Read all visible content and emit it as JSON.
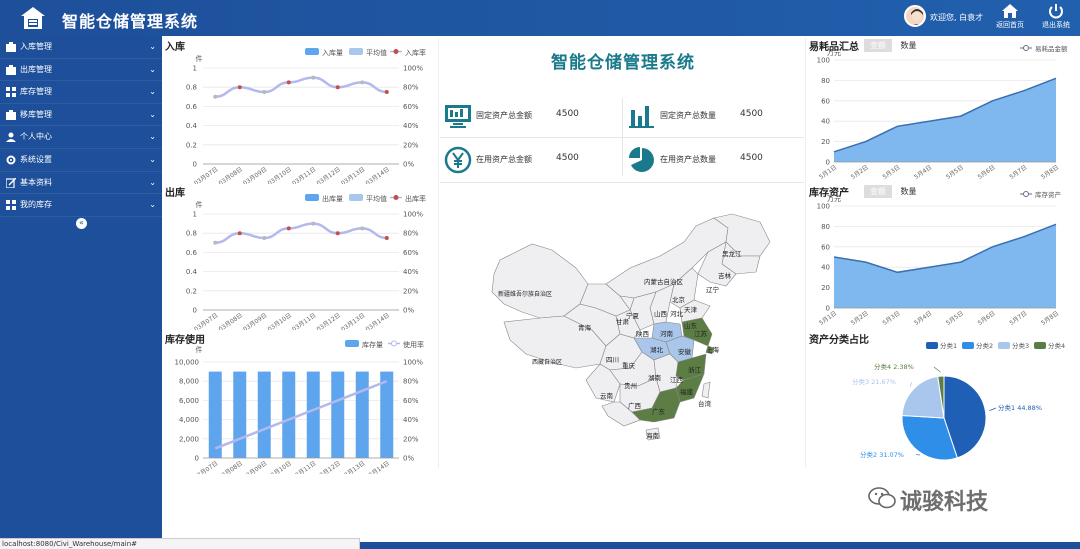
{
  "header": {
    "title": "智能仓储管理系统",
    "welcome": "欢迎您, 白袁才",
    "home_label": "返回首页",
    "logout_label": "退出系统"
  },
  "sidebar": {
    "items": [
      {
        "label": "入库管理",
        "icon": "inbound-icon"
      },
      {
        "label": "出库管理",
        "icon": "outbound-icon"
      },
      {
        "label": "库存管理",
        "icon": "inventory-icon"
      },
      {
        "label": "移库管理",
        "icon": "transfer-icon"
      },
      {
        "label": "个人中心",
        "icon": "user-icon"
      },
      {
        "label": "系统设置",
        "icon": "gear-icon"
      },
      {
        "label": "基本资料",
        "icon": "edit-icon"
      },
      {
        "label": "我的库存",
        "icon": "storage-icon"
      }
    ],
    "collapse_symbol": "«"
  },
  "dashboard": {
    "title": "智能仓储管理系统",
    "stats": [
      {
        "label": "固定资产总金额",
        "value": "4500",
        "icon": "monitor-icon"
      },
      {
        "label": "固定资产总数量",
        "value": "4500",
        "icon": "bar-chart-icon"
      },
      {
        "label": "在用资产总金额",
        "value": "4500",
        "icon": "yen-icon"
      },
      {
        "label": "在用资产总数量",
        "value": "4500",
        "icon": "pie-chart-icon"
      }
    ]
  },
  "status_url": "localhost:8080/Civi_Warehouse/main#",
  "watermark": "诚骏科技",
  "colors": {
    "header": "#1e4f9a",
    "bar": "#5ea5ee",
    "rate": "#b3b8ef",
    "area": "#7fb7ef",
    "teal": "#1a7a8c",
    "green": "#5c7e45",
    "pie": [
      "#1f5fb6",
      "#2f8fe8",
      "#a9c6ec",
      "#5c7e45"
    ]
  },
  "chart_data": [
    {
      "type": "line",
      "title": "入库",
      "categories": [
        "03月07日",
        "03月08日",
        "03月09日",
        "03月10日",
        "03月11日",
        "03月12日",
        "03月13日",
        "03月14日"
      ],
      "y_unit": "件",
      "ylim": [
        0,
        1
      ],
      "yticks": [
        0,
        0.2,
        0.4,
        0.6,
        0.8,
        1
      ],
      "y2ticks": [
        "0%",
        "20%",
        "40%",
        "60%",
        "80%",
        "100%"
      ],
      "legend": [
        "入库量",
        "平均值",
        "入库率"
      ],
      "series": [
        {
          "name": "入库率",
          "values": [
            0.7,
            0.8,
            0.75,
            0.85,
            0.9,
            0.8,
            0.85,
            0.75
          ]
        }
      ],
      "legend_placement": "top-right",
      "grid": true
    },
    {
      "type": "line",
      "title": "出库",
      "categories": [
        "03月07日",
        "03月08日",
        "03月09日",
        "03月10日",
        "03月11日",
        "03月12日",
        "03月13日",
        "03月14日"
      ],
      "y_unit": "件",
      "ylim": [
        0,
        1
      ],
      "yticks": [
        0,
        0.2,
        0.4,
        0.6,
        0.8,
        1
      ],
      "y2ticks": [
        "0%",
        "20%",
        "40%",
        "60%",
        "80%",
        "100%"
      ],
      "legend": [
        "出库量",
        "平均值",
        "出库率"
      ],
      "series": [
        {
          "name": "出库率",
          "values": [
            0.7,
            0.8,
            0.75,
            0.85,
            0.9,
            0.8,
            0.85,
            0.75
          ]
        }
      ],
      "legend_placement": "top-right",
      "grid": true
    },
    {
      "type": "bar",
      "title": "库存使用",
      "categories": [
        "03月07日",
        "03月08日",
        "03月09日",
        "03月10日",
        "03月11日",
        "03月12日",
        "03月13日",
        "03月14日"
      ],
      "y_unit": "件",
      "ylim": [
        0,
        10000
      ],
      "yticks": [
        "0",
        "2,000",
        "4,000",
        "6,000",
        "8,000",
        "10,000"
      ],
      "y2ticks": [
        "0%",
        "20%",
        "40%",
        "60%",
        "80%",
        "100%"
      ],
      "legend": [
        "库存量",
        "使用率"
      ],
      "series": [
        {
          "name": "库存量",
          "values": [
            9000,
            9000,
            9000,
            9000,
            9000,
            9000,
            9000,
            9000
          ]
        },
        {
          "name": "使用率",
          "values": [
            0.1,
            0.2,
            0.3,
            0.4,
            0.5,
            0.6,
            0.7,
            0.8
          ]
        }
      ],
      "legend_placement": "top-right",
      "grid": true
    },
    {
      "type": "area",
      "title": "易耗品汇总",
      "toggle": [
        "金额",
        "数量"
      ],
      "categories": [
        "5月1日",
        "5月2日",
        "5月3日",
        "5月4日",
        "5月5日",
        "5月6日",
        "5月7日",
        "5月8日"
      ],
      "y_unit": "万元",
      "ylim": [
        0,
        100
      ],
      "yticks": [
        0,
        20,
        40,
        60,
        80,
        100
      ],
      "legend": [
        "易耗品金额"
      ],
      "series": [
        {
          "name": "易耗品金额",
          "values": [
            10,
            20,
            35,
            40,
            45,
            60,
            70,
            82
          ]
        }
      ],
      "legend_placement": "top-right",
      "grid": true
    },
    {
      "type": "area",
      "title": "库存资产",
      "toggle": [
        "金额",
        "数量"
      ],
      "categories": [
        "5月1日",
        "5月2日",
        "5月3日",
        "5月4日",
        "5月5日",
        "5月6日",
        "5月7日",
        "5月8日"
      ],
      "y_unit": "万元",
      "ylim": [
        0,
        100
      ],
      "yticks": [
        0,
        20,
        40,
        60,
        80,
        100
      ],
      "legend": [
        "库存资产"
      ],
      "series": [
        {
          "name": "库存资产",
          "values": [
            50,
            45,
            35,
            40,
            45,
            60,
            70,
            82
          ]
        }
      ],
      "legend_placement": "top-right",
      "grid": true
    },
    {
      "type": "pie",
      "title": "资产分类占比",
      "legend": [
        "分类1",
        "分类2",
        "分类3",
        "分类4"
      ],
      "slices": [
        {
          "name": "分类1",
          "value": 44.88,
          "label": "分类1 44.88%"
        },
        {
          "name": "分类2",
          "value": 31.07,
          "label": "分类2 31.07%"
        },
        {
          "name": "分类3",
          "value": 21.67,
          "label": "分类3 21.67%"
        },
        {
          "name": "分类4",
          "value": 2.38,
          "label": "分类4 2.38%"
        }
      ],
      "legend_placement": "top"
    },
    {
      "type": "map",
      "title": "",
      "regions": [
        "新疆维吾尔族自治区",
        "西藏自治区",
        "青海",
        "甘肃",
        "四川",
        "云南",
        "内蒙古自治区",
        "黑龙江",
        "吉林",
        "辽宁",
        "北京",
        "天津",
        "河北",
        "山西",
        "宁夏",
        "陕西",
        "河南",
        "山东",
        "江苏",
        "安徽",
        "湖北",
        "上海",
        "重庆",
        "湖南",
        "江西",
        "浙江",
        "贵州",
        "福建",
        "广西",
        "广东",
        "台湾",
        "海南"
      ],
      "highlighted_green": [
        "江苏",
        "上海",
        "浙江",
        "福建",
        "广东"
      ],
      "highlighted_blue": [
        "安徽",
        "湖北",
        "河南"
      ]
    }
  ]
}
